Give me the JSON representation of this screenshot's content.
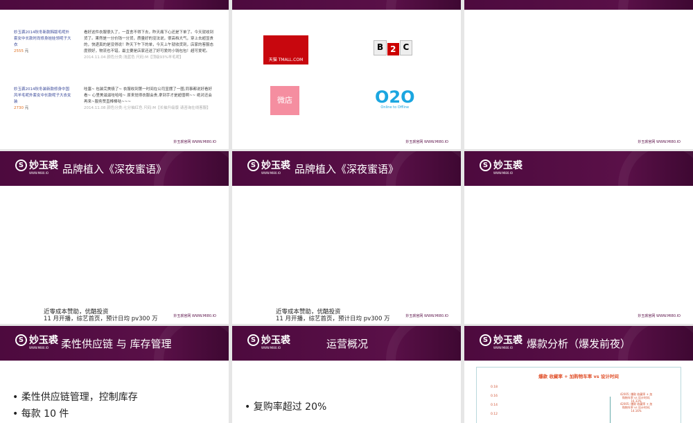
{
  "brand": {
    "logo_text": "妙玉裘",
    "logo_url": "WWW.MI80.IO",
    "footer": "妙玉裘官网 WWW.MI80.IO",
    "purple": "#4d0a3e"
  },
  "slides": [
    {
      "reviews": [
        {
          "product": "妙玉裘2014秋冬新款韩版毛呢外套女中长款时尚修身娃娃领呢子大衣",
          "price": "2555",
          "unit": "元",
          "review": "看好这件衣服很久了，一直舍不得下去，昨天痛下心还是下单了。今天就收到货了。果然是一分价钱一分货，质量好的没法说，很高档大气，穿上去超显贵的，快递真的是没得说！昨天下午下的单，今天上午就收货到，店家的客服态度很好，物流也不错，最主要是店家还送了好可爱的小钱包包！超可爱呢。",
          "meta": "2014.11.04 颜色分类:浅蓝色  尺码:M【顶级93%羊毛呢】"
        },
        {
          "product": "妙玉裘2014秋冬装新款修身中国风羊毛呢外套女中长款呢子大衣女装",
          "price": "2730",
          "unit": "元",
          "review": "哇塞~ 包装完美极了~ 衣服收到第一时间在公司显摆了一圈,同事都说好看好看~ 心里美滋滋哇哈哈~ 原来觉得衣服会贵,拿到手才是超值啊~~ 绝对还会再来~服务赞直棒棒哒~~~",
          "meta": "2014.11.08 颜色分类:七分袖红色  尺码:M【长袖升级版 请咨询在线客服】"
        }
      ]
    },
    {
      "logos": {
        "tmall": "天猫 TMALL.COM",
        "b2c_b": "B",
        "b2c_2": "2",
        "b2c_c": "C",
        "weidian": "微店",
        "o2o": "O2O",
        "o2o_sub": "Online to Offline"
      }
    },
    {},
    {
      "title": "品牌植入《深夜蜜语》",
      "lines": [
        "近零成本赞助，优酷投资",
        "11 月开播，综艺首页，预计日均 pv300 万"
      ]
    },
    {
      "title": "品牌植入《深夜蜜语》",
      "lines": [
        "近零成本赞助，优酷投资",
        "11 月开播，综艺首页，预计日均 pv300 万"
      ]
    },
    {},
    {
      "title": "柔性供应链 与 库存管理",
      "bullets": [
        "柔性供应链管理，控制库存",
        "每款 10 件"
      ]
    },
    {
      "title": "运营概况",
      "bullets": [
        "复购率超过 20%"
      ]
    },
    {
      "title": "爆款分析（爆发前夜）"
    }
  ],
  "chart_data": {
    "type": "line",
    "title": "爆款 收藏率 + 加购物车率 vs 设计时间",
    "yticks": [
      "0.18",
      "0.16",
      "0.14",
      "0.12"
    ],
    "annotations": [
      "42005; 爆款 收藏率 + 加购物车率 vs 设计时间; 16.33%",
      "42005; 爆款 收藏率 + 加购物车率 vs 设计时间; 14.16%"
    ],
    "ylim": [
      0.12,
      0.18
    ]
  }
}
